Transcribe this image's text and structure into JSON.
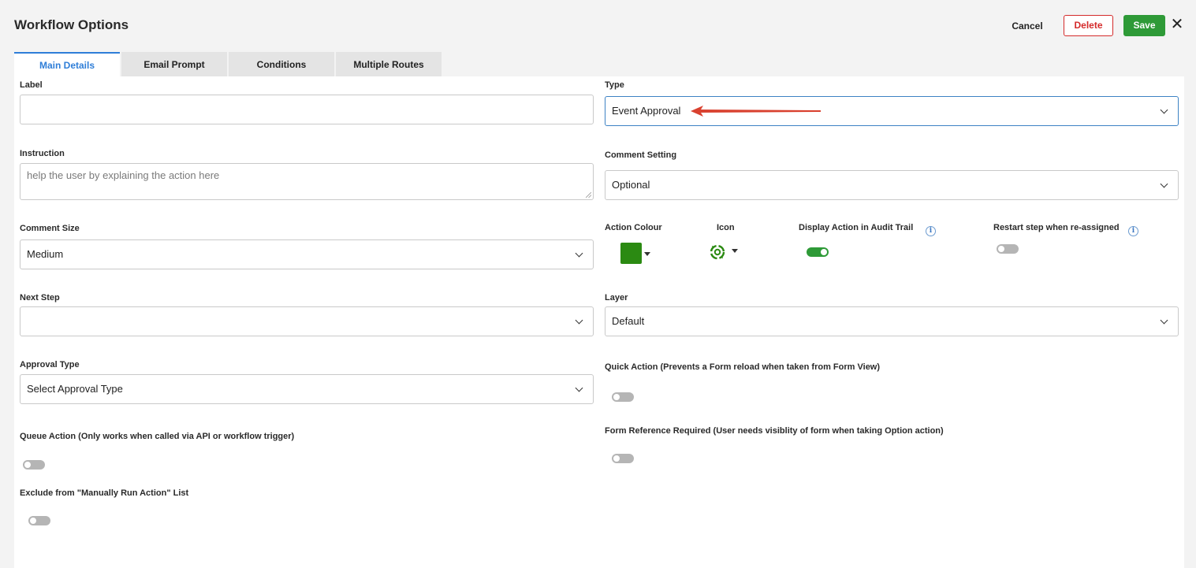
{
  "header": {
    "title": "Workflow Options",
    "cancel_label": "Cancel",
    "delete_label": "Delete",
    "save_label": "Save",
    "close_glyph": "✕"
  },
  "tabs": [
    {
      "label": "Main Details",
      "active": true
    },
    {
      "label": "Email Prompt",
      "active": false
    },
    {
      "label": "Conditions",
      "active": false
    },
    {
      "label": "Multiple Routes",
      "active": false
    }
  ],
  "form": {
    "label": {
      "label": "Label",
      "value": ""
    },
    "type": {
      "label": "Type",
      "value": "Event Approval"
    },
    "instruction": {
      "label": "Instruction",
      "placeholder": "help the user by explaining the action here"
    },
    "comment_setting": {
      "label": "Comment Setting",
      "value": "Optional"
    },
    "comment_size": {
      "label": "Comment Size",
      "value": "Medium"
    },
    "action_colour": {
      "label": "Action Colour",
      "color": "#2b8a12"
    },
    "icon": {
      "label": "Icon",
      "icon_name": "recycle-gear-icon"
    },
    "display_action_audit": {
      "label": "Display Action in Audit Trail",
      "on": true
    },
    "restart_step": {
      "label": "Restart step when re-assigned",
      "on": false
    },
    "next_step": {
      "label": "Next Step",
      "value": ""
    },
    "layer": {
      "label": "Layer",
      "value": "Default"
    },
    "approval_type": {
      "label": "Approval Type",
      "value": "Select Approval Type"
    },
    "quick_action": {
      "label": "Quick Action (Prevents a Form reload when taken from Form View)",
      "on": false
    },
    "queue_action": {
      "label": "Queue Action (Only works when called via API or workflow trigger)",
      "on": false
    },
    "form_reference": {
      "label": "Form Reference Required (User needs visiblity of form when taking Option action)",
      "on": false
    },
    "exclude_manual": {
      "label": "Exclude from \"Manually Run Action\" List",
      "on": false
    }
  },
  "info_glyph": "i",
  "colors": {
    "accent": "#2f7ed8",
    "save": "#2e9a37",
    "delete": "#d42a2a",
    "annotation_arrow": "#d9412f"
  }
}
